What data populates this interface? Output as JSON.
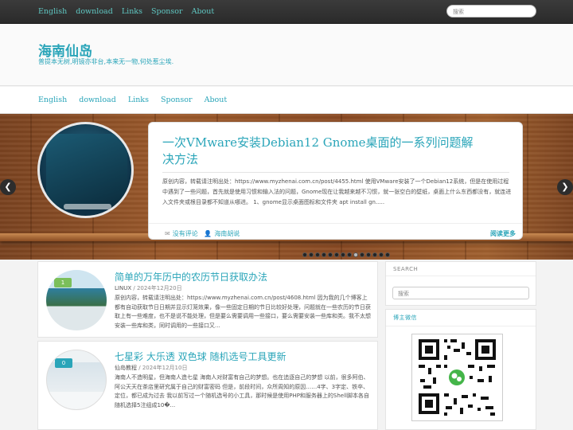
{
  "topbar": {
    "links": [
      "English",
      "download",
      "Links",
      "Sponsor",
      "About"
    ],
    "search_placeholder": "搜索"
  },
  "header": {
    "site_title": "海南仙岛",
    "tagline": "普提本无树,明镜亦非台,本来无一物,何处惹尘埃."
  },
  "nav": {
    "links": [
      "English",
      "download",
      "Links",
      "Sponsor",
      "About"
    ]
  },
  "slider": {
    "title": "一次VMware安装Debian12 Gnome桌面的一系列问题解决方法",
    "excerpt": "原创内容，转载请注明出处：https://www.myzhenai.com.cn/post/4455.html 使用VMware安装了一个Debian12系统，但是在使用过程中遇到了一些问题，首先就是使用习惯和输入法的问题，Gnome现在让我越来越不习惯，就一张空白的壁纸，桌面上什么东西都没有，就连进入文件夹或根目录都不知道从哪进。 1、gnome显示桌面图标和文件夹 apt install gn.....",
    "comments": "没有评论",
    "author": "海南胡说",
    "read_more": "阅读更多",
    "prev_icon": "chevron-left-icon",
    "next_icon": "chevron-right-icon",
    "dot_count": 14,
    "active_dot": 8
  },
  "posts": [
    {
      "title": "简单的万年历中的农历节日获取办法",
      "category": "LINUX",
      "date": "/ 2024年12月20日",
      "badge": "1",
      "badge_color": "#7bbf5a",
      "excerpt": "原创内容，转载请注明出处：https://www.myzhenai.com.cn/post/4608.html 因为我的几个博客上都有自动获取节日日期并显示灯笼效果，像一些固定日期的节日比较好处理，问题就在一些农历的节日获取上有一些难度，也不是说不能处理，但是要么需要调用一些接口，要么需要安装一些库和类。我不太想安装一些库和类，同时调用的一些接口又..."
    },
    {
      "title": "七星彩 大乐透 双色球 随机选号工具更新",
      "category": "仙岛教程",
      "date": "/ 2024年12月10日",
      "badge": "0",
      "badge_color": "#2aa5b9",
      "excerpt": "海南人不造明星，但海南人造七星 海南人对财富有自己的梦想。也在追逐自己的梦想 以前，很多阿伯、阿公天天在茶店里研究属于自己的财富密码 但是，前段时间，众所周知的原因……4字、3字定、铁卒、定位，都已成为过去 我以前写过一个随机选号的小工具，那时候是使用PHP和服务器上的Shell脚本各自随机选择5注组成10�..."
    }
  ],
  "sidebar": {
    "search_title": "SEARCH",
    "search_placeholder": "搜索",
    "wechat_title": "博主微信"
  },
  "colors": {
    "accent": "#2aa5b9",
    "topbar": "#2f2f2f",
    "wood": "#8a4b24"
  }
}
